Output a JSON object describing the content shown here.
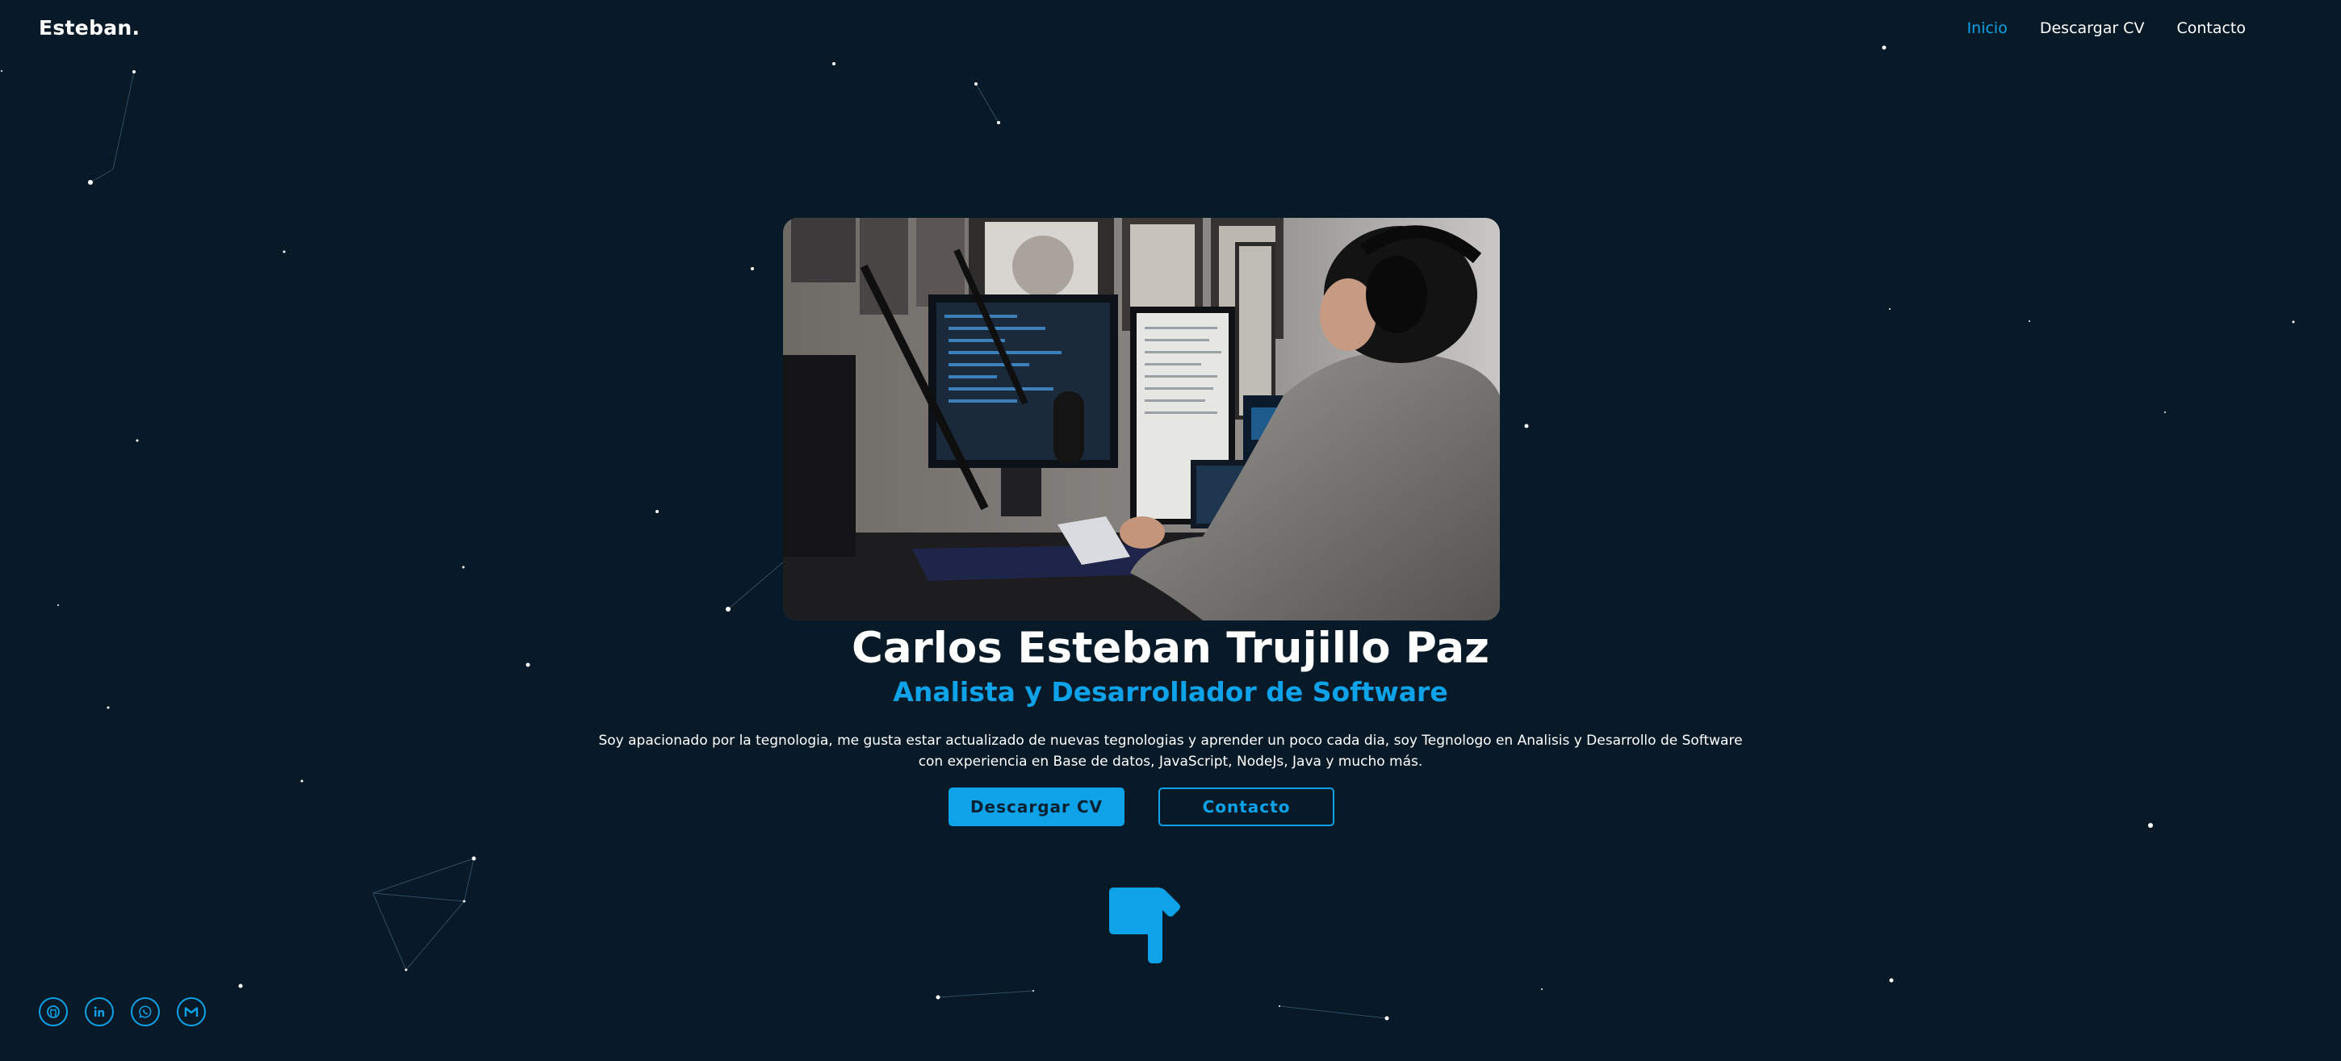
{
  "header": {
    "logo": "Esteban.",
    "nav": [
      {
        "label": "Inicio",
        "active": true
      },
      {
        "label": "Descargar CV",
        "active": false
      },
      {
        "label": "Contacto",
        "active": false
      }
    ]
  },
  "hero": {
    "name": "Carlos Esteban Trujillo Paz",
    "role": "Analista y Desarrollador de Software",
    "bio_line1": "Soy apacionado por la tegnologia, me gusta estar actualizado de nuevas tegnologias y aprender un poco cada dia, soy Tegnologo en Analisis y Desarrollo de Software",
    "bio_line2": "con experiencia en Base de datos, JavaScript, NodeJs, Java y mucho más.",
    "primary_button": "Descargar CV",
    "secondary_button": "Contacto"
  },
  "socials": [
    {
      "icon": "github-icon"
    },
    {
      "icon": "linkedin-icon"
    },
    {
      "icon": "whatsapp-icon"
    },
    {
      "icon": "gmail-icon"
    }
  ],
  "colors": {
    "background": "#081a28",
    "accent": "#0ea2e8",
    "text": "#ffffff"
  }
}
